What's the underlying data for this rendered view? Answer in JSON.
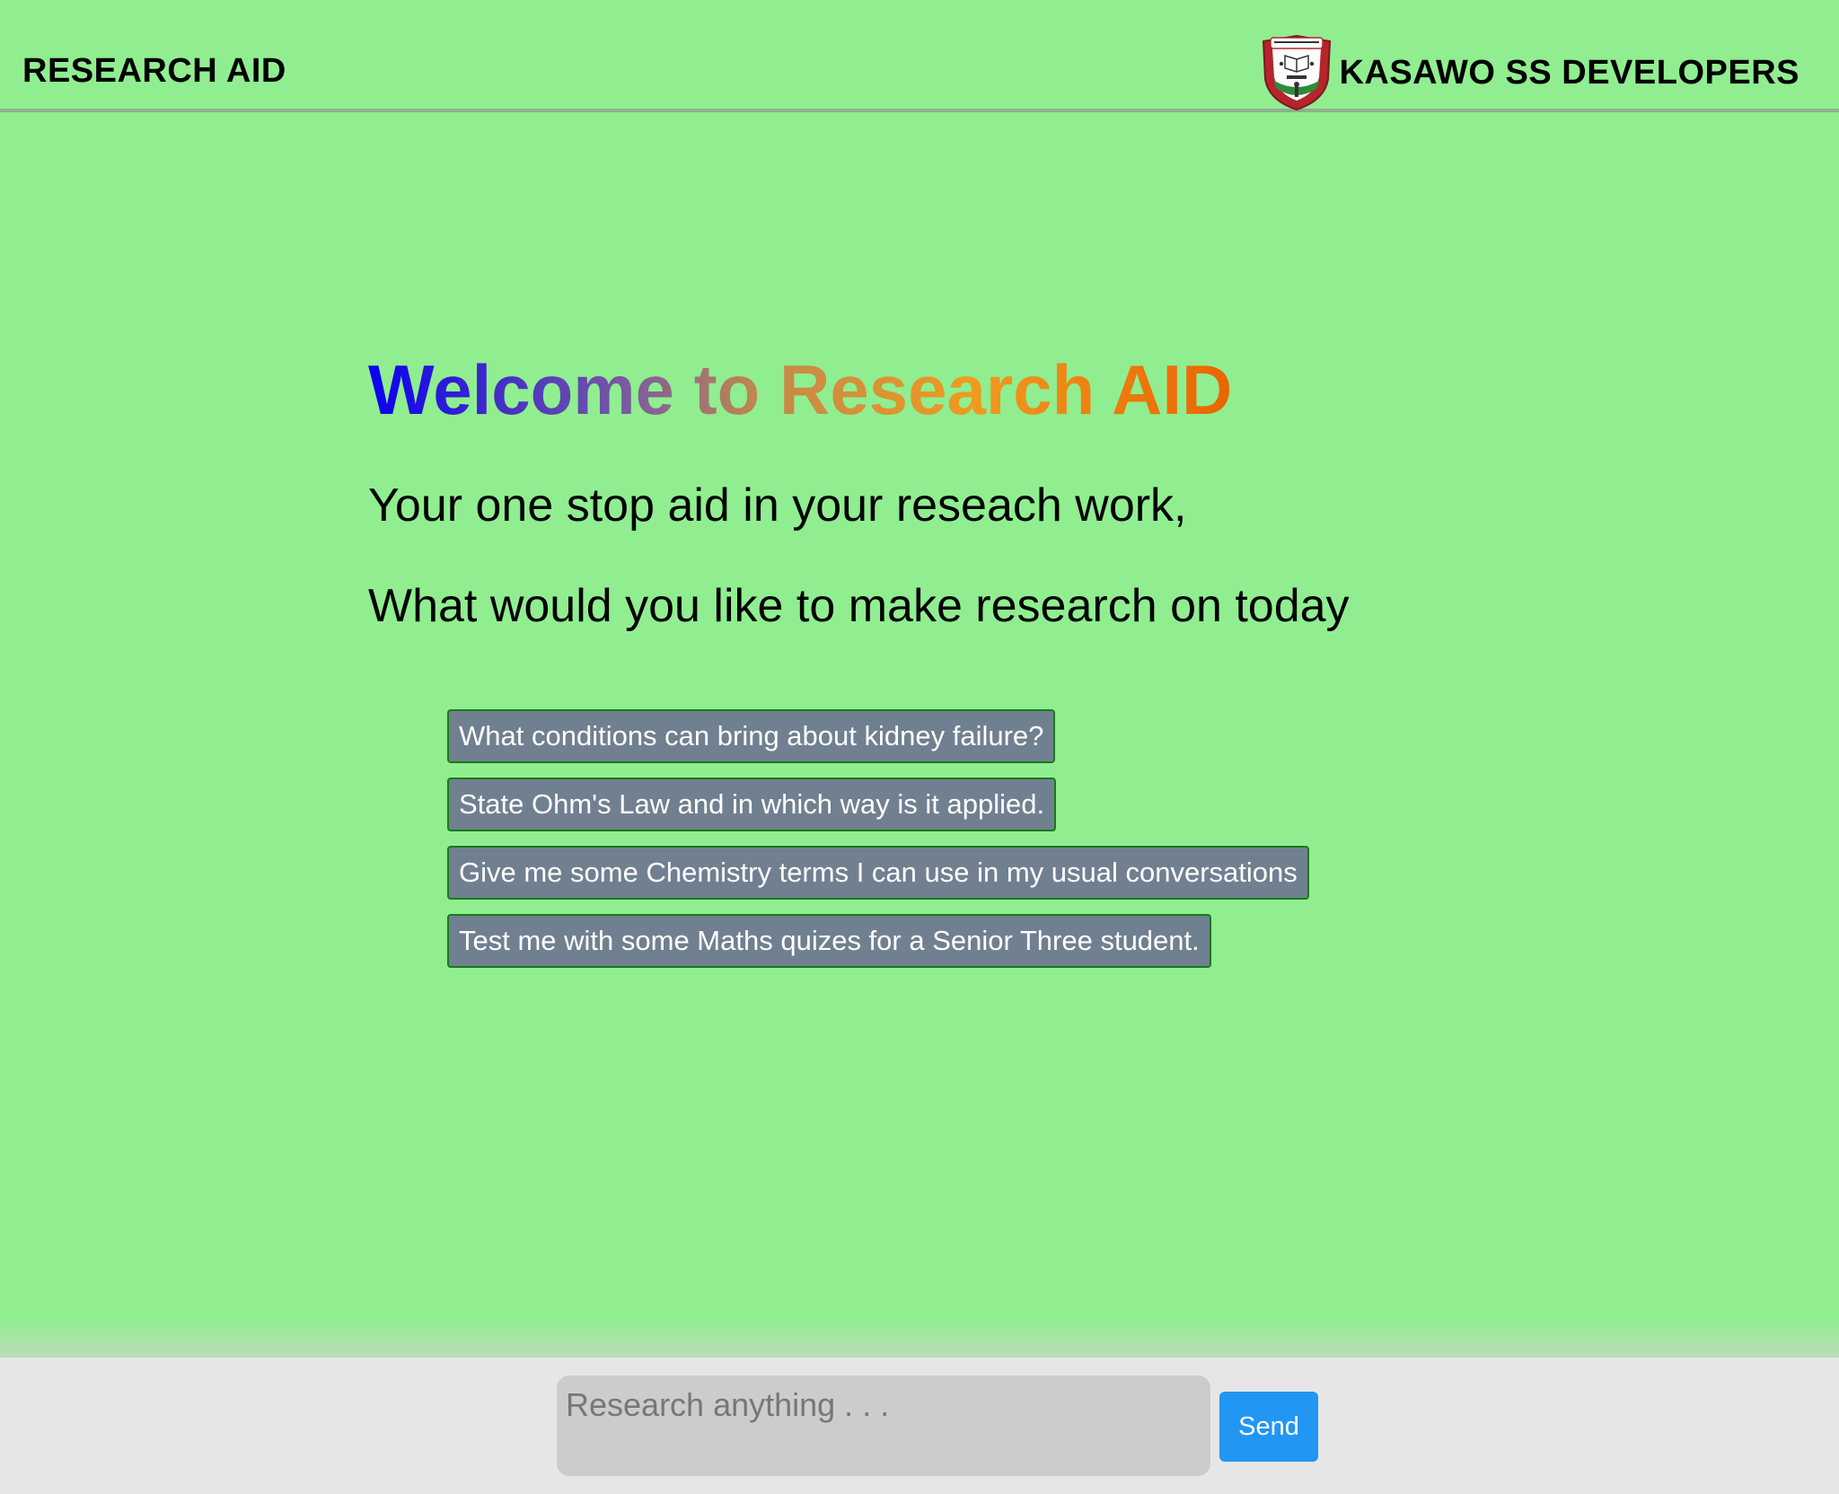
{
  "header": {
    "brand": "RESEARCH AID",
    "developer": "KASAWO SS DEVELOPERS",
    "logo_icon": "school-crest-icon"
  },
  "main": {
    "welcome": "Welcome to Research AID",
    "line1": "Your one stop aid in your reseach work,",
    "line2": "What would you like to make research on today"
  },
  "suggestions": [
    "What conditions can bring about kidney failure?",
    "State Ohm's Law and in which way is it applied.",
    "Give me some Chemistry terms I can use in my usual conversations",
    "Test me with some Maths quizes for a Senior Three student."
  ],
  "footer": {
    "input_placeholder": "Research anything . . .",
    "input_value": "",
    "send_label": "Send"
  },
  "colors": {
    "background": "#90ee90",
    "suggestion_bg": "#708090",
    "suggestion_border": "#1a7a1a",
    "send_bg": "#2196f3",
    "footer_bg": "#e6e6e6",
    "input_bg": "#cccccc",
    "title_gradient": [
      "#0a00f0",
      "#7a5aa0",
      "#c0884e",
      "#f09a20",
      "#ea6400"
    ]
  }
}
